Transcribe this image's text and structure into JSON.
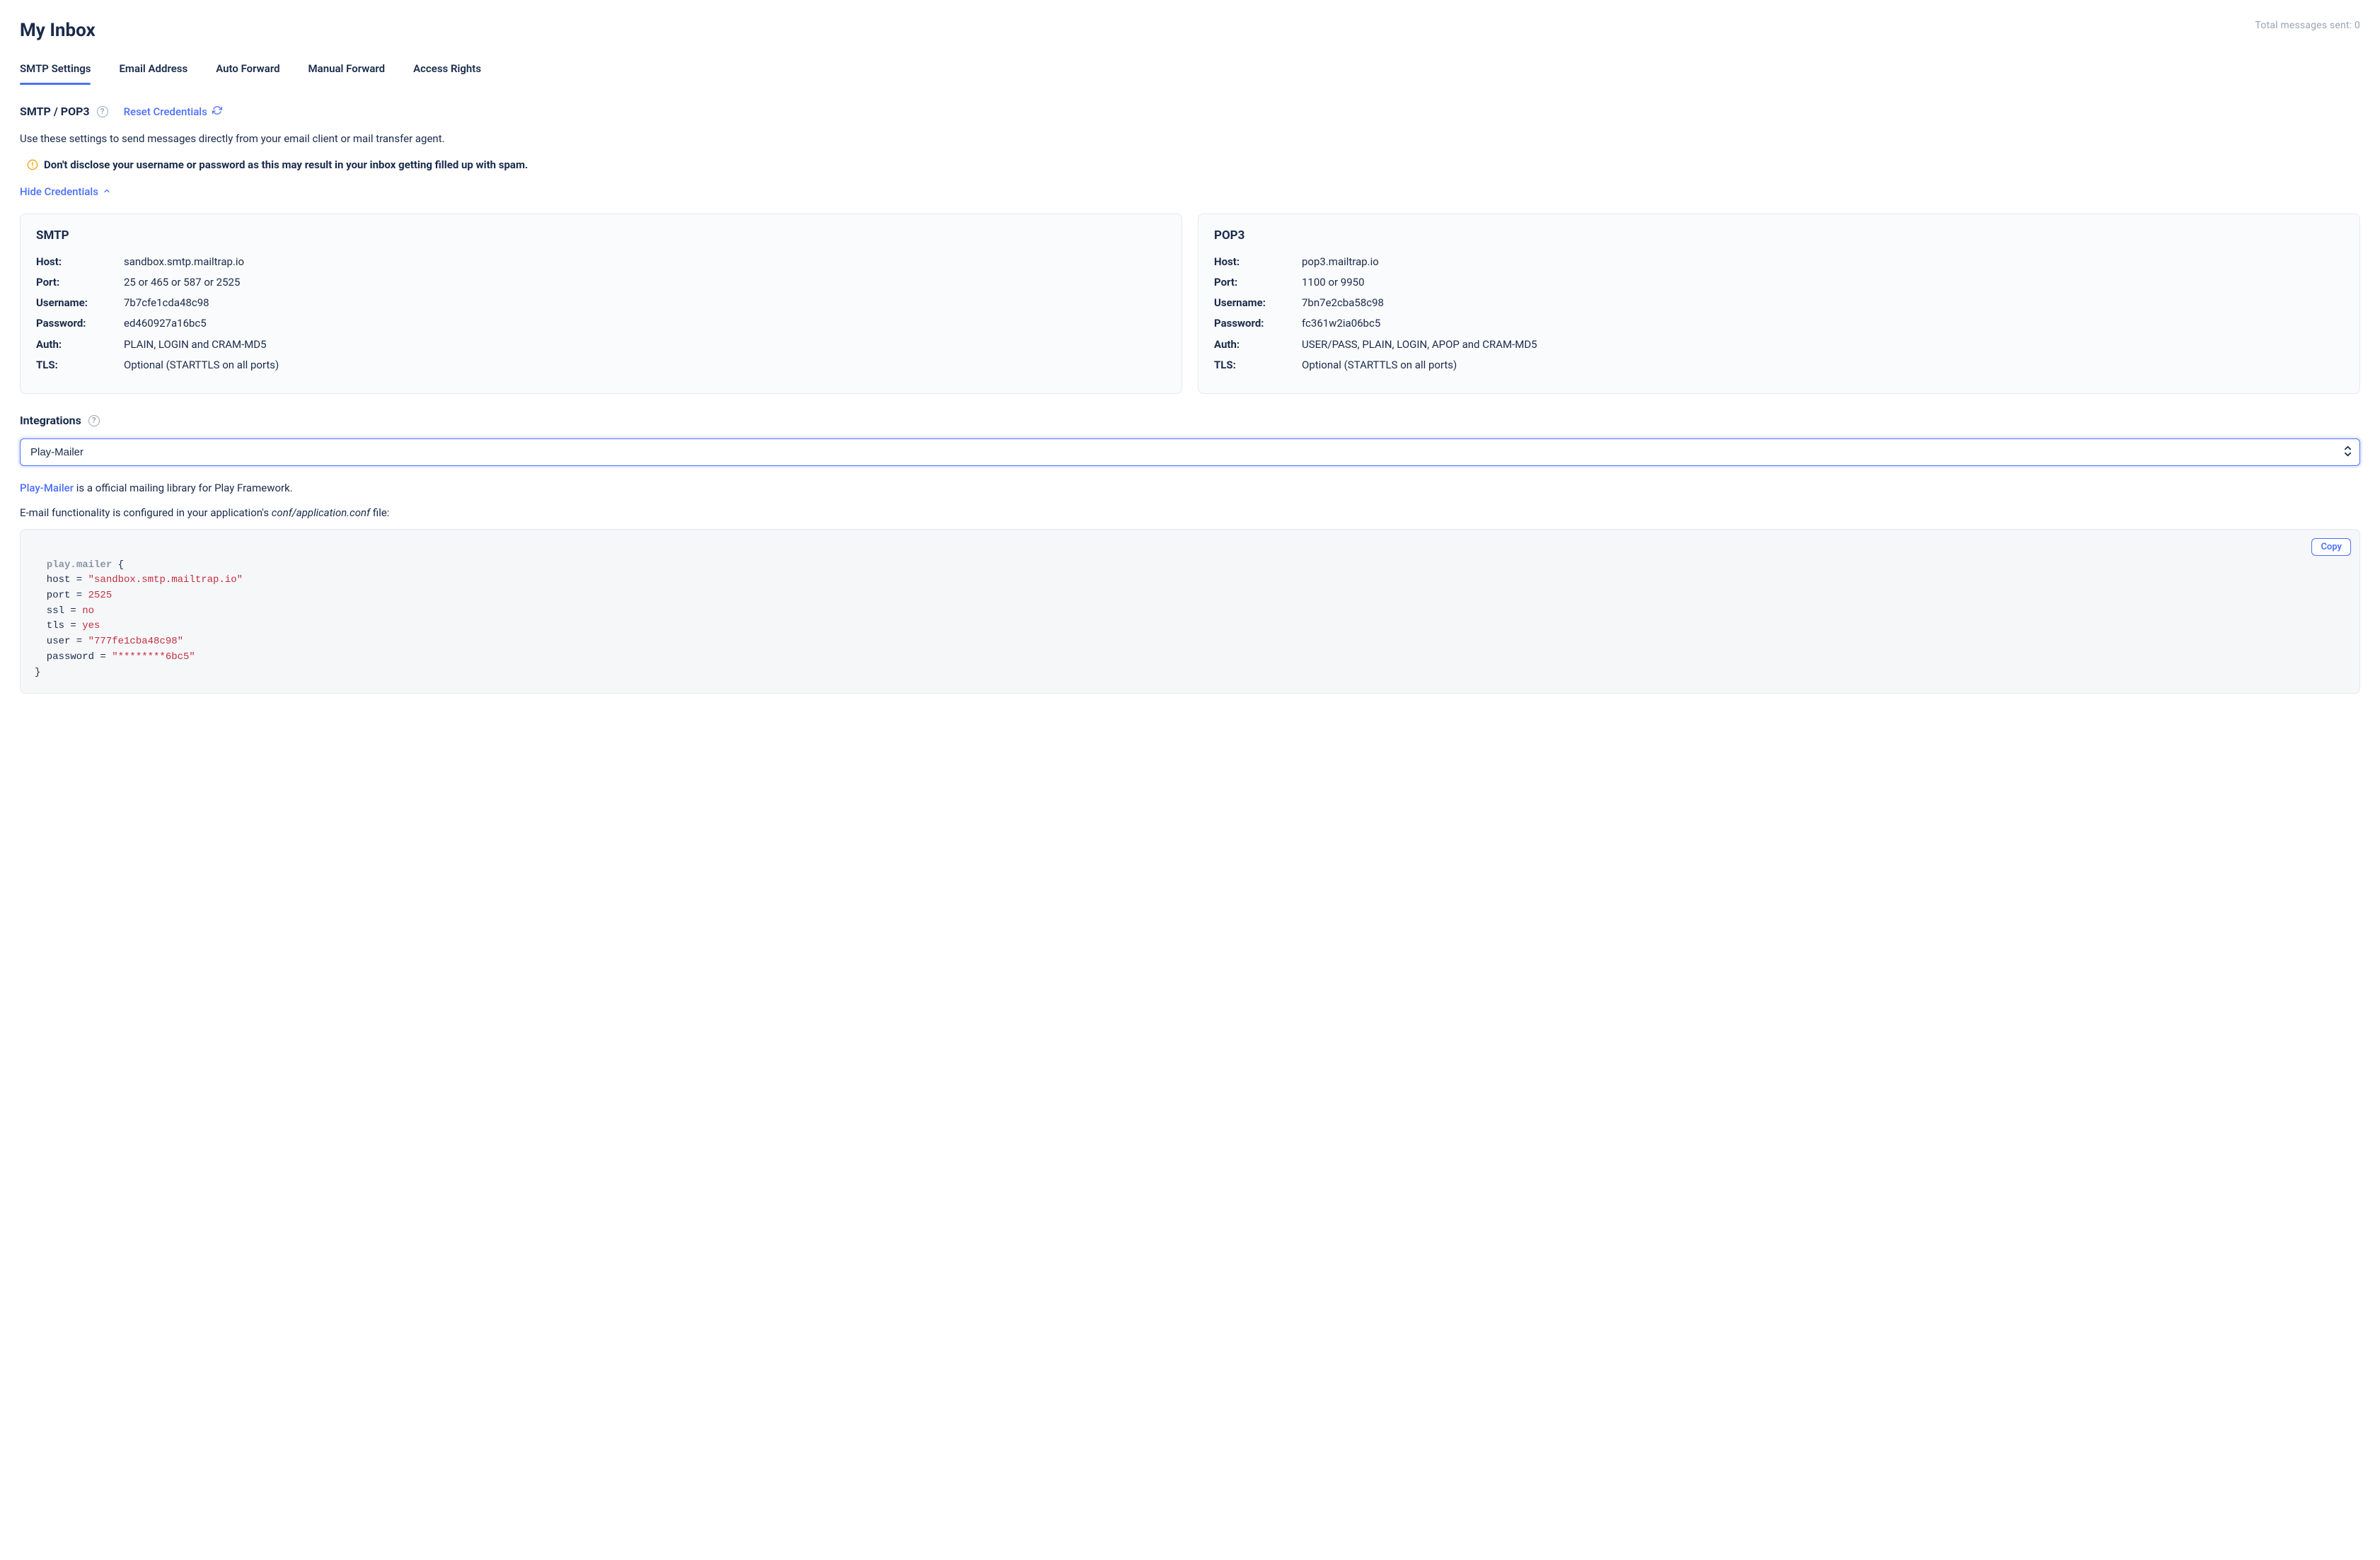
{
  "header": {
    "title": "My Inbox",
    "total_messages_label": "Total messages sent: 0"
  },
  "tabs": [
    {
      "label": "SMTP Settings",
      "active": true
    },
    {
      "label": "Email Address",
      "active": false
    },
    {
      "label": "Auto Forward",
      "active": false
    },
    {
      "label": "Manual Forward",
      "active": false
    },
    {
      "label": "Access Rights",
      "active": false
    }
  ],
  "smtp_section": {
    "title": "SMTP / POP3",
    "reset_label": "Reset Credentials",
    "description": "Use these settings to send messages directly from your email client or mail transfer agent.",
    "warning": "Don't disclose your username or password as this may result in your inbox getting filled up with spam.",
    "toggle_label": "Hide Credentials"
  },
  "smtp_card": {
    "title": "SMTP",
    "rows": [
      {
        "label": "Host:",
        "value": "sandbox.smtp.mailtrap.io"
      },
      {
        "label": "Port:",
        "value": "25 or 465 or 587 or 2525"
      },
      {
        "label": "Username:",
        "value": "7b7cfe1cda48c98"
      },
      {
        "label": "Password:",
        "value": "ed460927a16bc5"
      },
      {
        "label": "Auth:",
        "value": "PLAIN, LOGIN and CRAM-MD5"
      },
      {
        "label": "TLS:",
        "value": "Optional (STARTTLS on all ports)"
      }
    ]
  },
  "pop3_card": {
    "title": "POP3",
    "rows": [
      {
        "label": "Host:",
        "value": "pop3.mailtrap.io"
      },
      {
        "label": "Port:",
        "value": "1100 or 9950"
      },
      {
        "label": "Username:",
        "value": "7bn7e2cba58c98"
      },
      {
        "label": "Password:",
        "value": "fc361w2ia06bc5"
      },
      {
        "label": "Auth:",
        "value": "USER/PASS, PLAIN, LOGIN, APOP and CRAM-MD5"
      },
      {
        "label": "TLS:",
        "value": "Optional (STARTTLS on all ports)"
      }
    ]
  },
  "integrations": {
    "title": "Integrations",
    "selected": "Play-Mailer",
    "link_text": "Play-Mailer",
    "desc_after_link": " is a official mailing library for Play Framework.",
    "config_line_before": "E-mail functionality is configured in your application's ",
    "config_file": "conf/application.conf",
    "config_line_after": " file:",
    "copy_label": "Copy"
  },
  "code": {
    "root_key": "play.mailer",
    "lines": [
      {
        "key": "host",
        "op": "=",
        "value": "\"sandbox.smtp.mailtrap.io\"",
        "kind": "str"
      },
      {
        "key": "port",
        "op": "=",
        "value": "2525",
        "kind": "num"
      },
      {
        "key": "ssl",
        "op": "=",
        "value": "no",
        "kind": "bool"
      },
      {
        "key": "tls",
        "op": "=",
        "value": "yes",
        "kind": "bool"
      },
      {
        "key": "user",
        "op": "=",
        "value": "\"777fe1cba48c98\"",
        "kind": "str"
      },
      {
        "key": "password",
        "op": "=",
        "value": "\"********6bc5\"",
        "kind": "str"
      }
    ]
  }
}
